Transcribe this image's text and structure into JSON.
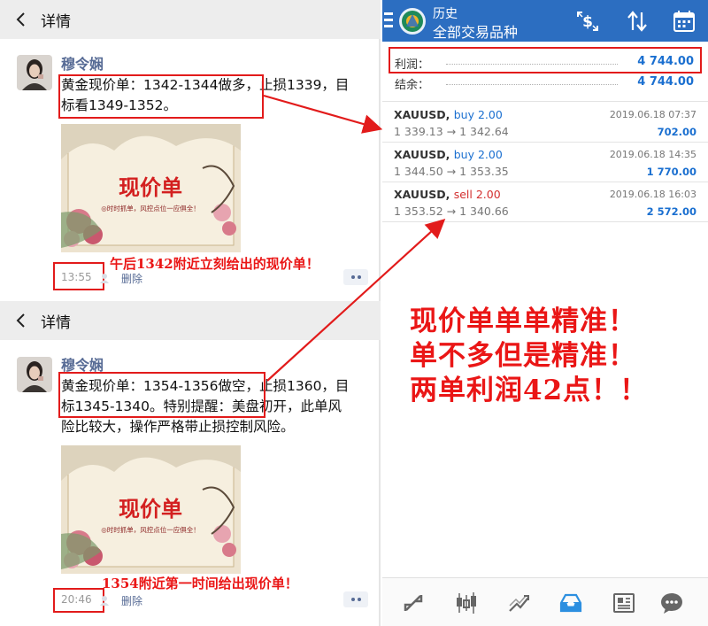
{
  "left": {
    "posts": [
      {
        "header_title": "详情",
        "author": "穆令娴",
        "text_line1": "黄金现价单：1342-1344做多，止损1339，目",
        "text_line2": "标看1349-1352。",
        "image_title": "现价单",
        "image_slogan": "◎时时抓单，风控点位一应俱全！",
        "time": "13:55",
        "delete_label": "删除",
        "annotation": "午后1342附近立刻给出的现价单！"
      },
      {
        "header_title": "详情",
        "author": "穆令娴",
        "text_line1": "黄金现价单：1354-1356做空，止损1360，目",
        "text_line2": "标1345-1340。特别提醒：美盘初开，此单风",
        "text_line3": "险比较大，操作严格带止损控制风险。",
        "image_title": "现价单",
        "image_slogan": "◎时时抓单，风控点位一应俱全！",
        "time": "20:46",
        "delete_label": "删除",
        "annotation": "1354附近第一时间给出现价单！"
      }
    ]
  },
  "right": {
    "title_small": "历史",
    "title_main": "全部交易品种",
    "summary": [
      {
        "label": "利润：",
        "value": "4 744.00"
      },
      {
        "label": "结余：",
        "value": "4 744.00"
      }
    ],
    "trades": [
      {
        "symbol": "XAUUSD,",
        "side": "buy 2.00",
        "side_type": "buy",
        "prices": "1 339.13 → 1 342.64",
        "datetime": "2019.06.18 07:37",
        "profit": "702.00"
      },
      {
        "symbol": "XAUUSD,",
        "side": "buy 2.00",
        "side_type": "buy",
        "prices": "1 344.50 → 1 353.35",
        "datetime": "2019.06.18 14:35",
        "profit": "1 770.00"
      },
      {
        "symbol": "XAUUSD,",
        "side": "sell 2.00",
        "side_type": "sell",
        "prices": "1 353.52 → 1 340.66",
        "datetime": "2019.06.18 16:03",
        "profit": "2 572.00"
      }
    ],
    "overlay_lines": [
      "现价单单单精准！",
      "单不多但是精准！",
      "两单利润42点！！"
    ],
    "colors": {
      "toolbar": "#2c6ec1",
      "profit": "#1a6fd0",
      "sell": "#d32f2f",
      "annotation": "#ea1616"
    }
  }
}
